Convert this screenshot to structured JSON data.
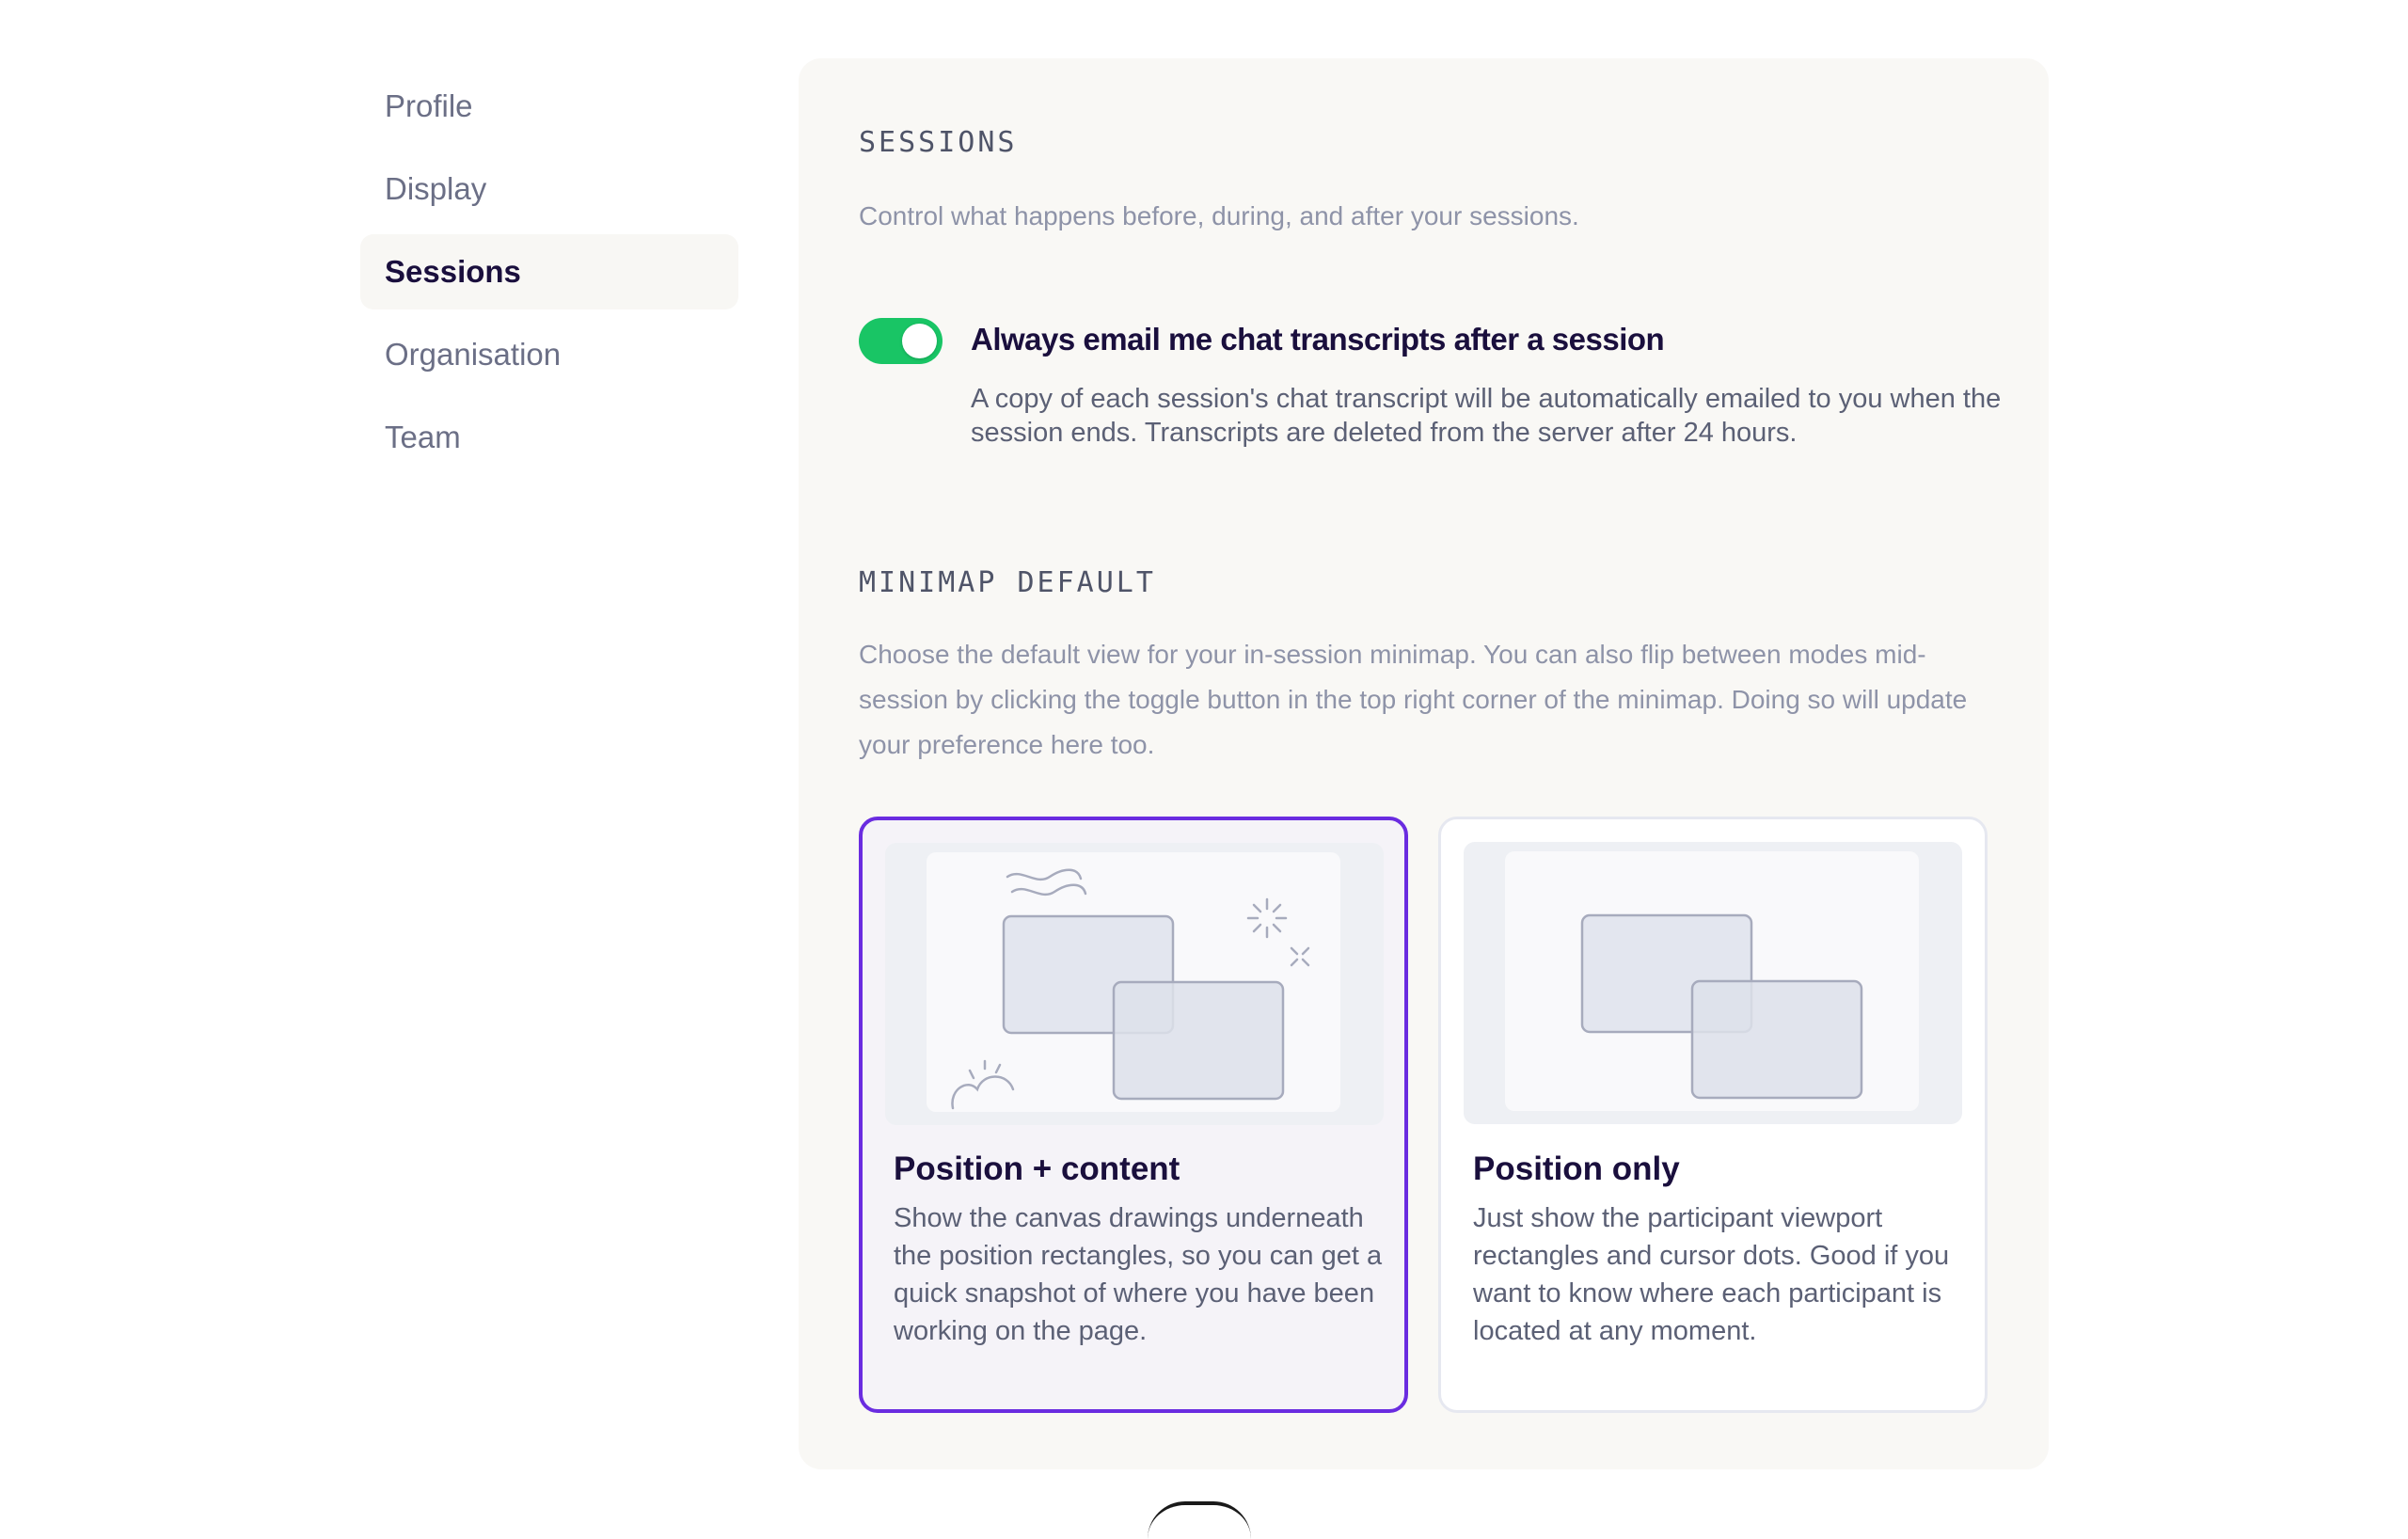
{
  "sidebar": {
    "items": [
      {
        "label": "Profile"
      },
      {
        "label": "Display"
      },
      {
        "label": "Sessions",
        "active": true
      },
      {
        "label": "Organisation"
      },
      {
        "label": "Team"
      }
    ]
  },
  "sessions": {
    "heading": "SESSIONS",
    "description": "Control what happens before, during, and after your sessions.",
    "email_toggle": {
      "on": true,
      "title": "Always email me chat transcripts after a session",
      "description": "A copy of each session's chat transcript will be automatically emailed to you when the session ends. Transcripts are deleted from the server after 24 hours."
    }
  },
  "minimap": {
    "heading": "MINIMAP DEFAULT",
    "description": "Choose the default view for your in-session minimap. You can also flip between modes mid-session by clicking the toggle button in the top right corner of the minimap. Doing so will update your preference here too.",
    "options": [
      {
        "title": "Position + content",
        "description": "Show the canvas drawings underneath the position rectangles, so you can get a quick snapshot of where you have been working on the page.",
        "selected": true
      },
      {
        "title": "Position only",
        "description": "Just show the participant viewport rectangles and cursor dots. Good if you want to know where each participant is located at any moment.",
        "selected": false
      }
    ]
  },
  "colors": {
    "accent": "#6a2ce0",
    "toggle_on": "#19c565",
    "text_primary": "#1a0f3d",
    "text_muted": "#8e93a8"
  }
}
